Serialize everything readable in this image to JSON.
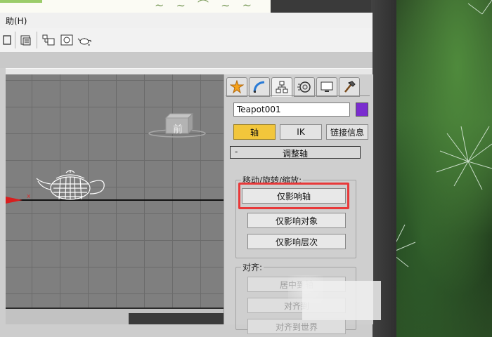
{
  "menu": {
    "help_label": "助(H)"
  },
  "command_panel": {
    "tabs": [
      {
        "icon": "create-star-icon"
      },
      {
        "icon": "modify-arc-icon"
      },
      {
        "icon": "hierarchy-icon",
        "active": true
      },
      {
        "icon": "motion-icon"
      },
      {
        "icon": "display-icon"
      },
      {
        "icon": "utilities-hammer-icon"
      }
    ],
    "object_name": "Teapot001",
    "object_color": "#7a2ccf",
    "mode_tabs": [
      "轴",
      "IK",
      "链接信息"
    ],
    "active_mode": "轴",
    "rollout_title": "调整轴",
    "rollout_toggle": "-",
    "move_group_label": "移动/旋转/缩放:",
    "move_buttons": [
      "仅影响轴",
      "仅影响对象",
      "仅影响层次"
    ],
    "align_group_label": "对齐:",
    "align_buttons": [
      "居中到轴",
      "对齐到",
      "对齐到世界"
    ]
  },
  "viewport": {
    "axis_label": "x",
    "viewcube_face": "前"
  },
  "colors": {
    "active_tab_highlight": "#f2c63b",
    "annotation_box": "#e8393a"
  }
}
